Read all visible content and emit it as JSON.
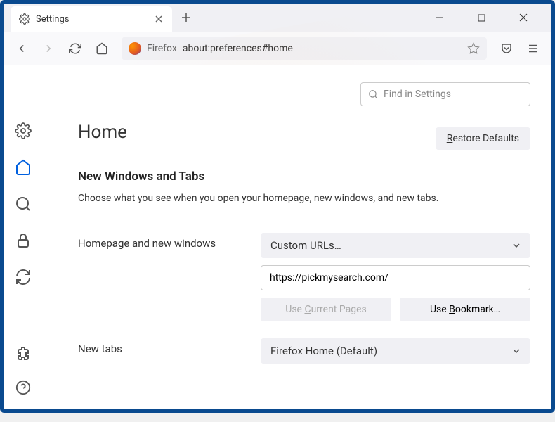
{
  "tab": {
    "title": "Settings"
  },
  "urlbar": {
    "prefix": "Firefox",
    "url": "about:preferences#home"
  },
  "search": {
    "placeholder": "Find in Settings"
  },
  "page": {
    "title": "Home",
    "restore_label": "Restore Defaults",
    "section_title": "New Windows and Tabs",
    "section_desc": "Choose what you see when you open your homepage, new windows, and new tabs."
  },
  "homepage": {
    "label": "Homepage and new windows",
    "dropdown": "Custom URLs…",
    "url_value": "https://pickmysearch.com/",
    "use_current": "Use Current Pages",
    "use_bookmark": "Use Bookmark…"
  },
  "newtabs": {
    "label": "New tabs",
    "dropdown": "Firefox Home (Default)"
  }
}
